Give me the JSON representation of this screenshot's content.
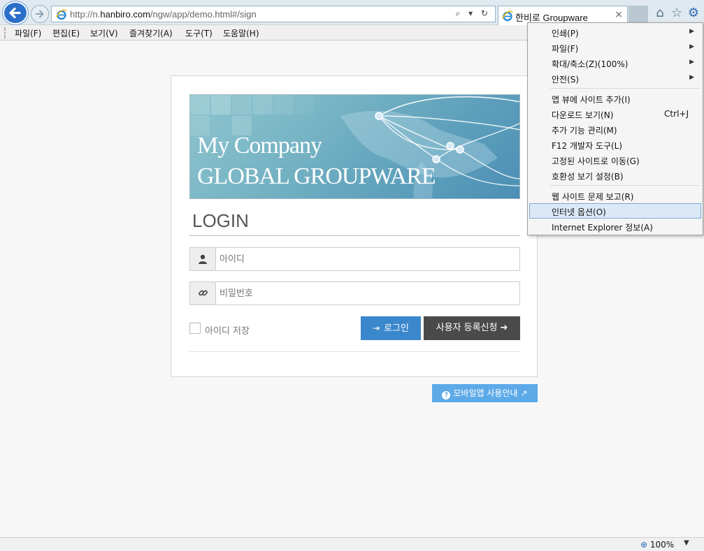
{
  "browser": {
    "url_prefix": "http://n.",
    "url_domain": "hanbiro.com",
    "url_path": "/ngw/app/demo.html#/sign",
    "tab_title": "한비로 Groupware",
    "tab_close": "×",
    "address_tools": "⌕ ▾ ↻",
    "home_icon": "⌂",
    "star_icon": "☆",
    "gear_icon": "⚙"
  },
  "menubar": [
    "파일(F)",
    "편집(E)",
    "보기(V)",
    "즐겨찾기(A)",
    "도구(T)",
    "도움말(H)"
  ],
  "banner": {
    "line1": "My Company",
    "line2": "GLOBAL GROUPWARE"
  },
  "login": {
    "title": "LOGIN",
    "id_placeholder": "아이디",
    "password_placeholder": "비밀번호",
    "remember_label": "아이디 저장",
    "login_button": "로그인",
    "register_button": "사용자 등록신청",
    "mobile_button": "모바일앱 사용안내"
  },
  "statusbar": {
    "zoom": "100%"
  },
  "tools_menu": {
    "groups": [
      [
        {
          "label": "인쇄(P)",
          "submenu": true
        },
        {
          "label": "파일(F)",
          "submenu": true
        },
        {
          "label": "확대/축소(Z)(100%)",
          "submenu": true
        },
        {
          "label": "안전(S)",
          "submenu": true
        }
      ],
      [
        {
          "label": "앱 뷰에 사이트 추가(I)"
        },
        {
          "label": "다운로드 보기(N)",
          "shortcut": "Ctrl+J"
        },
        {
          "label": "추가 기능 관리(M)"
        },
        {
          "label": "F12 개발자 도구(L)"
        },
        {
          "label": "고정된 사이트로 이동(G)"
        },
        {
          "label": "호환성 보기 설정(B)"
        }
      ],
      [
        {
          "label": "웹 사이트 문제 보고(R)"
        },
        {
          "label": "인터넷 옵션(O)",
          "highlighted": true
        },
        {
          "label": "Internet Explorer 정보(A)"
        }
      ]
    ]
  },
  "colors": {
    "login_button": "#3a87cc",
    "register_button": "#4a4a4a",
    "mobile_button": "#5daae8",
    "menu_highlight": "#dbe9f6"
  }
}
